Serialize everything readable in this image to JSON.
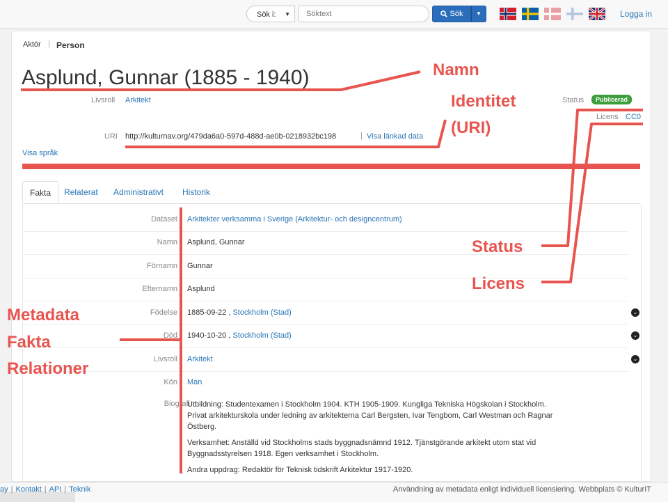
{
  "topbar": {
    "scope_label": "Sök i:",
    "search_placeholder": "Söktext",
    "search_button": "Sök",
    "login": "Logga in",
    "flags": [
      "norwegian-flag-icon",
      "swedish-flag-icon",
      "danish-flag-icon",
      "finnish-flag-icon",
      "english-flag-icon"
    ]
  },
  "breadcrumb": {
    "item1": "Aktör",
    "separator": "|",
    "item2": "Person"
  },
  "title": "Asplund, Gunnar (1885 - 1940)",
  "header": {
    "livsroll_label": "Livsroll",
    "livsroll_value": "Arkitekt",
    "uri_label": "URI",
    "uri_value": "http://kulturnav.org/479da6a0-597d-488d-ae0b-0218932bc198",
    "uri_sep": "|",
    "linked_data": "Visa länkad data",
    "show_language": "Visa språk",
    "status_label": "Status",
    "status_value": "Publicerad",
    "license_label": "Licens",
    "license_value": "CC0"
  },
  "tabs": [
    "Fakta",
    "Relaterat",
    "Administrativt",
    "Historik"
  ],
  "facts": [
    {
      "key": "Dataset",
      "value": "Arkitekter verksamma i Sverige (Arkitektur- och designcentrum)",
      "link": true
    },
    {
      "key": "Namn",
      "value": "Asplund, Gunnar"
    },
    {
      "key": "Förnamn",
      "value": "Gunnar"
    },
    {
      "key": "Efternamn",
      "value": "Asplund"
    },
    {
      "key": "Födelse",
      "value": "1885-09-22 , ",
      "place": "Stockholm (Stad)"
    },
    {
      "key": "Död",
      "value": "1940-10-20 , ",
      "place": "Stockholm (Stad)"
    },
    {
      "key": "Livsroll",
      "value": "Arkitekt",
      "link": true
    },
    {
      "key": "Kön",
      "value": "Man",
      "link": true
    }
  ],
  "biography": {
    "label": "Biografi",
    "paragraphs": [
      "Utbildning: Studentexamen i Stockholm 1904. KTH 1905-1909. Kungliga Tekniska Högskolan i Stockholm. Privat arkitekturskola under ledning av arkitekterna Carl Bergsten, Ivar Tengbom, Carl Westman och Ragnar Östberg.",
      "Verksamhet: Anställd vid Stockholms stads byggnadsnämnd 1912. Tjänstgörande arkitekt utom stat vid Byggnadsstyrelsen 1918. Egen verksamhet i Stockholm.",
      "Andra uppdrag: Redaktör för Teknisk tidskrift Arkitektur 1917-1920."
    ]
  },
  "footer": {
    "left_items": [
      "ay",
      "Kontakt",
      "API",
      "Teknik"
    ],
    "right_text": "Användning av metadata enligt individuell licensiering. Webbplats © KulturIT"
  },
  "annotations": {
    "namn": "Namn",
    "identitet_line1": "Identitet",
    "identitet_line2": "(URI)",
    "status": "Status",
    "licens": "Licens",
    "metadata": "Metadata",
    "fakta": "Fakta",
    "relationer": "Relationer",
    "color": "#e85550"
  },
  "colors": {
    "link": "#2a76b6",
    "badge": "#3c9e3c",
    "primary_button": "#2a6ebb"
  }
}
